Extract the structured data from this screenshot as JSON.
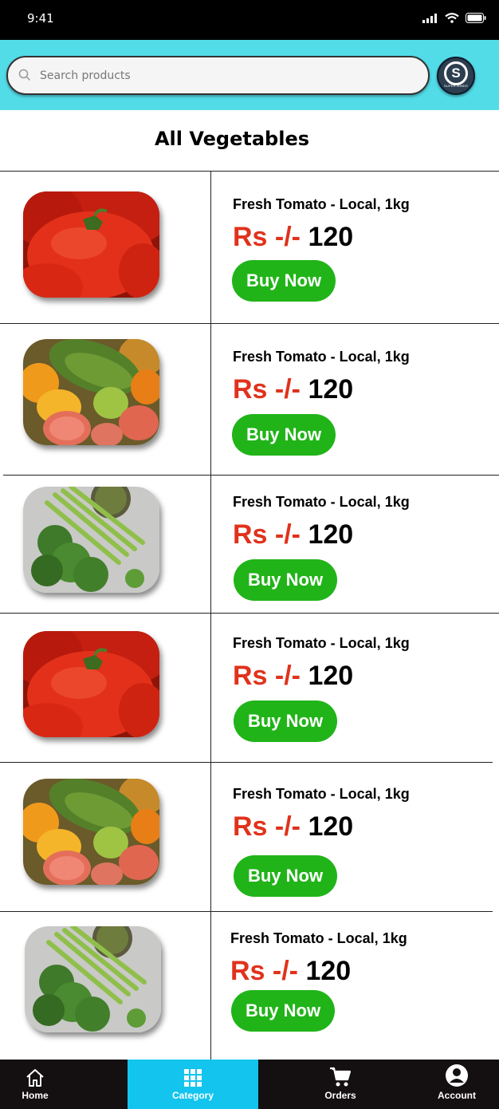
{
  "status_bar": {
    "time": "9:41"
  },
  "search": {
    "placeholder": "Search products"
  },
  "logo": {
    "letter": "S",
    "text": "SUPER MINDS"
  },
  "page": {
    "title": "All Vegetables"
  },
  "products": [
    {
      "name": "Fresh Tomato - Local, 1kg",
      "currency": "Rs -/-",
      "price": "120",
      "button": "Buy Now",
      "image": "tomato"
    },
    {
      "name": "Fresh Tomato - Local, 1kg",
      "currency": "Rs -/-",
      "price": "120",
      "button": "Buy Now",
      "image": "fruits"
    },
    {
      "name": "Fresh Tomato - Local, 1kg",
      "currency": "Rs -/-",
      "price": "120",
      "button": "Buy Now",
      "image": "broccoli-asparagus"
    },
    {
      "name": "Fresh Tomato - Local, 1kg",
      "currency": "Rs -/-",
      "price": "120",
      "button": "Buy Now",
      "image": "tomato"
    },
    {
      "name": "Fresh Tomato - Local, 1kg",
      "currency": "Rs -/-",
      "price": "120",
      "button": "Buy Now",
      "image": "fruits"
    },
    {
      "name": "Fresh Tomato - Local, 1kg",
      "currency": "Rs -/-",
      "price": "120",
      "button": "Buy Now",
      "image": "broccoli-asparagus"
    }
  ],
  "nav": {
    "items": [
      {
        "label": "Home",
        "icon": "home-icon",
        "active": false
      },
      {
        "label": "Category",
        "icon": "grid-icon",
        "active": true
      },
      {
        "label": "Orders",
        "icon": "cart-icon",
        "active": false
      },
      {
        "label": "Account",
        "icon": "account-icon",
        "active": false
      }
    ]
  },
  "colors": {
    "header": "#52dce8",
    "price_currency": "#e0321c",
    "buy_button": "#21b419",
    "nav_background": "#141011",
    "nav_active": "#12c4ee"
  }
}
